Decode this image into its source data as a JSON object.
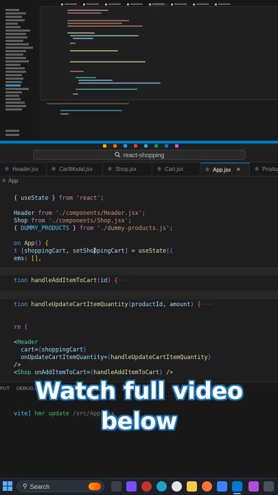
{
  "window": {
    "command_center": "react-shopping"
  },
  "tabs": [
    {
      "label": "Header.jsx",
      "italic": false
    },
    {
      "label": "CartModal.jsx",
      "italic": true
    },
    {
      "label": "Shop.jsx",
      "italic": false
    },
    {
      "label": "Cart.jsx",
      "italic": false
    },
    {
      "label": "App.jsx",
      "italic": false,
      "active": true
    },
    {
      "label": "Product",
      "italic": false
    }
  ],
  "breadcrumb": {
    "item": "App"
  },
  "code": {
    "l1": {
      "a": "{ ",
      "b": "useState",
      "c": " } ",
      "d": "from",
      "e": " 'react';"
    },
    "l2": {
      "a": "Header",
      "b": " from ",
      "c": "'./components/Header.jsx';"
    },
    "l3": {
      "a": "Shop",
      "b": " from ",
      "c": "'./components/Shop.jsx';"
    },
    "l4": {
      "a": "{ ",
      "b": "DUMMY_PRODUCTS",
      "c": " } ",
      "d": "from",
      "e": " './dummy-products.js';"
    },
    "l5": {
      "a": "on ",
      "b": "App",
      "c": "() ",
      "d": "{"
    },
    "l6": {
      "a": "t ",
      "b": "[",
      "c": "shoppingCart",
      "d": ", ",
      "e": "setShoppingCart",
      "f": "]",
      "g": " = ",
      "h": "useState",
      "i": "(",
      "j": "{"
    },
    "l7": {
      "a": "ems",
      "b": ": ",
      "c": "[]",
      "d": ","
    },
    "l8": {
      "a": "tion ",
      "b": "handleAddItemToCart",
      "c": "(",
      "d": "id",
      "e": ") ",
      "f": "{",
      "g": "···"
    },
    "l9": {
      "a": "tion ",
      "b": "handleUpdateCartItemQuantity",
      "c": "(",
      "d": "productId",
      "e": ", ",
      "f": "amount",
      "g": ") ",
      "h": "{",
      "i": "···"
    },
    "l10": {
      "a": "rn ",
      "b": "("
    },
    "l11": {
      "a": "<",
      "b": "Header"
    },
    "l12": {
      "a": "cart",
      "b": "=",
      "c": "{",
      "d": "shoppingCart",
      "e": "}"
    },
    "l13": {
      "a": "onUpdateCartItemQuantity",
      "b": "=",
      "c": "{",
      "d": "handleUpdateCartItemQuantity",
      "e": "}"
    },
    "l14": {
      "a": "/>"
    },
    "l15": {
      "a": "Shop ",
      "b": "onAddItemToCart",
      "c": "=",
      "d": "{",
      "e": "handleAddItemToCart",
      "f": "}",
      "g": " />"
    },
    "l16": {
      "a": ">"
    }
  },
  "panel": {
    "tabs": [
      "PUT",
      "DEBUG CONSOLE"
    ],
    "terminal": {
      "prefix": "vite]",
      "hmr": " hmr update ",
      "path": "/src/App.jsx"
    }
  },
  "overlay": {
    "line1": "Watch full video",
    "line2": "below"
  },
  "taskbar": {
    "search_label": "Search"
  },
  "colors": {
    "accent": "#0078d4",
    "overlay_stroke": "#1b73b8",
    "status_bar": "#007acc"
  }
}
